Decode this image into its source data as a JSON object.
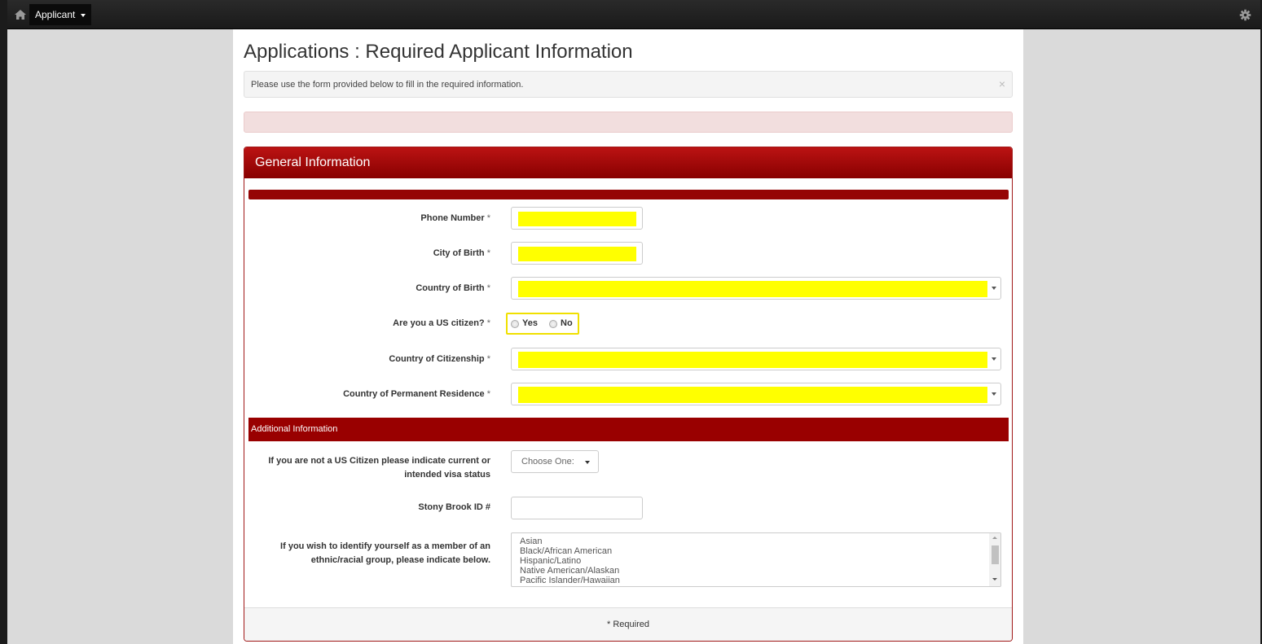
{
  "navbar": {
    "home_icon": "home-icon",
    "applicant_label": "Applicant",
    "settings_icon": "gear-icon"
  },
  "page": {
    "title": "Applications : Required Applicant Information",
    "info_message": "Please use the form provided below to fill in the required information.",
    "info_close": "×"
  },
  "panel": {
    "heading": "General Information",
    "fields": {
      "phone_number": {
        "label": "Phone Number",
        "required_mark": "*",
        "value": ""
      },
      "city_of_birth": {
        "label": "City of Birth",
        "required_mark": "*",
        "value": ""
      },
      "country_of_birth": {
        "label": "Country of Birth",
        "required_mark": "*",
        "value": ""
      },
      "us_citizen": {
        "label": "Are you a US citizen?",
        "required_mark": "*",
        "options": [
          "Yes",
          "No"
        ]
      },
      "country_of_citizenship": {
        "label": "Country of Citizenship",
        "required_mark": "*",
        "value": ""
      },
      "country_of_residence": {
        "label": "Country of Permanent Residence",
        "required_mark": "*",
        "value": ""
      }
    },
    "additional": {
      "heading": "Additional Information",
      "visa_label_line1": "If you are not a US Citizen please indicate current or",
      "visa_label_line2": "intended visa status",
      "visa_select": "Choose One:",
      "stony_brook_label": "Stony Brook ID #",
      "stony_brook_value": "",
      "ethnic_label_line1": "If you wish to identify yourself as a member of an",
      "ethnic_label_line2": "ethnic/racial group, please indicate below.",
      "ethnic_options": [
        "Asian",
        "Black/African American",
        "Hispanic/Latino",
        "Native American/Alaskan",
        "Pacific Islander/Hawaiian"
      ]
    },
    "footer": "* Required"
  },
  "colors": {
    "panel_header": "#aa0a0a",
    "highlight": "#ffff00",
    "navbar": "#1f1f1f",
    "side_background": "#dadada",
    "error_alert": "#f2dede"
  }
}
